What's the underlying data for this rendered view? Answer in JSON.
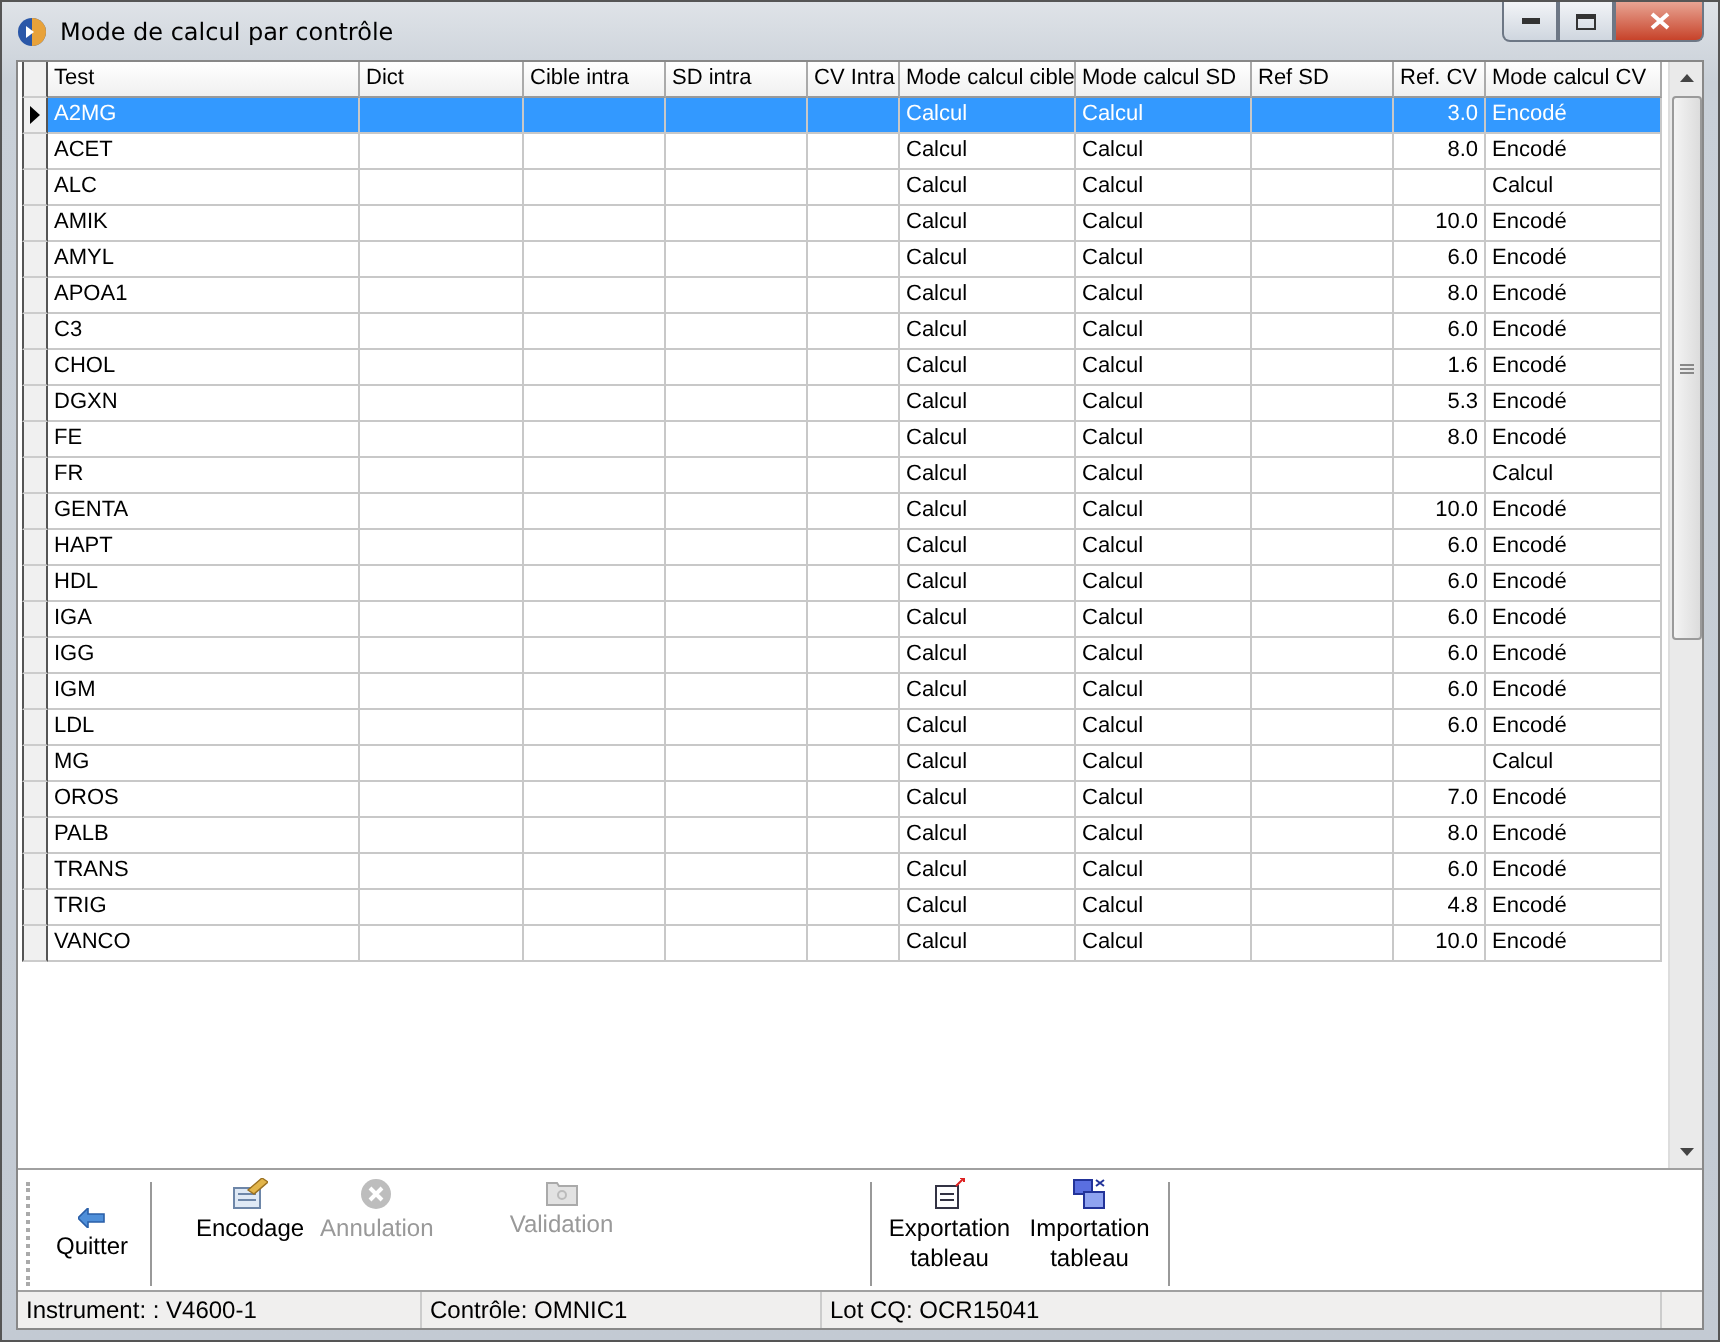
{
  "window": {
    "title": "Mode de calcul par contrôle"
  },
  "table": {
    "columns": [
      "Test",
      "Dict",
      "Cible intra",
      "SD intra",
      "CV Intra",
      "Mode calcul cible",
      "Mode calcul SD",
      "Ref SD",
      "Ref. CV",
      "Mode calcul CV"
    ],
    "rows": [
      {
        "test": "A2MG",
        "mode_cible": "Calcul",
        "mode_sd": "Calcul",
        "ref_cv": "3.0",
        "mode_cv": "Encodé",
        "selected": true
      },
      {
        "test": "ACET",
        "mode_cible": "Calcul",
        "mode_sd": "Calcul",
        "ref_cv": "8.0",
        "mode_cv": "Encodé",
        "selected": false
      },
      {
        "test": "ALC",
        "mode_cible": "Calcul",
        "mode_sd": "Calcul",
        "mode_cv": "Calcul",
        "selected": false
      },
      {
        "test": "AMIK",
        "mode_cible": "Calcul",
        "mode_sd": "Calcul",
        "ref_cv": "10.0",
        "mode_cv": "Encodé",
        "selected": false
      },
      {
        "test": "AMYL",
        "mode_cible": "Calcul",
        "mode_sd": "Calcul",
        "ref_cv": "6.0",
        "mode_cv": "Encodé",
        "selected": false
      },
      {
        "test": "APOA1",
        "mode_cible": "Calcul",
        "mode_sd": "Calcul",
        "ref_cv": "8.0",
        "mode_cv": "Encodé",
        "selected": false
      },
      {
        "test": "C3",
        "mode_cible": "Calcul",
        "mode_sd": "Calcul",
        "ref_cv": "6.0",
        "mode_cv": "Encodé",
        "selected": false
      },
      {
        "test": "CHOL",
        "mode_cible": "Calcul",
        "mode_sd": "Calcul",
        "ref_cv": "1.6",
        "mode_cv": "Encodé",
        "selected": false
      },
      {
        "test": "DGXN",
        "mode_cible": "Calcul",
        "mode_sd": "Calcul",
        "ref_cv": "5.3",
        "mode_cv": "Encodé",
        "selected": false
      },
      {
        "test": "FE",
        "mode_cible": "Calcul",
        "mode_sd": "Calcul",
        "ref_cv": "8.0",
        "mode_cv": "Encodé",
        "selected": false
      },
      {
        "test": "FR",
        "mode_cible": "Calcul",
        "mode_sd": "Calcul",
        "mode_cv": "Calcul",
        "selected": false
      },
      {
        "test": "GENTA",
        "mode_cible": "Calcul",
        "mode_sd": "Calcul",
        "ref_cv": "10.0",
        "mode_cv": "Encodé",
        "selected": false
      },
      {
        "test": "HAPT",
        "mode_cible": "Calcul",
        "mode_sd": "Calcul",
        "ref_cv": "6.0",
        "mode_cv": "Encodé",
        "selected": false
      },
      {
        "test": "HDL",
        "mode_cible": "Calcul",
        "mode_sd": "Calcul",
        "ref_cv": "6.0",
        "mode_cv": "Encodé",
        "selected": false
      },
      {
        "test": "IGA",
        "mode_cible": "Calcul",
        "mode_sd": "Calcul",
        "ref_cv": "6.0",
        "mode_cv": "Encodé",
        "selected": false
      },
      {
        "test": "IGG",
        "mode_cible": "Calcul",
        "mode_sd": "Calcul",
        "ref_cv": "6.0",
        "mode_cv": "Encodé",
        "selected": false
      },
      {
        "test": "IGM",
        "mode_cible": "Calcul",
        "mode_sd": "Calcul",
        "ref_cv": "6.0",
        "mode_cv": "Encodé",
        "selected": false
      },
      {
        "test": "LDL",
        "mode_cible": "Calcul",
        "mode_sd": "Calcul",
        "ref_cv": "6.0",
        "mode_cv": "Encodé",
        "selected": false
      },
      {
        "test": "MG",
        "mode_cible": "Calcul",
        "mode_sd": "Calcul",
        "mode_cv": "Calcul",
        "selected": false
      },
      {
        "test": "OROS",
        "mode_cible": "Calcul",
        "mode_sd": "Calcul",
        "ref_cv": "7.0",
        "mode_cv": "Encodé",
        "selected": false
      },
      {
        "test": "PALB",
        "mode_cible": "Calcul",
        "mode_sd": "Calcul",
        "ref_cv": "8.0",
        "mode_cv": "Encodé",
        "selected": false
      },
      {
        "test": "TRANS",
        "mode_cible": "Calcul",
        "mode_sd": "Calcul",
        "ref_cv": "6.0",
        "mode_cv": "Encodé",
        "selected": false
      },
      {
        "test": "TRIG",
        "mode_cible": "Calcul",
        "mode_sd": "Calcul",
        "ref_cv": "4.8",
        "mode_cv": "Encodé",
        "selected": false
      },
      {
        "test": "VANCO",
        "mode_cible": "Calcul",
        "mode_sd": "Calcul",
        "ref_cv": "10.0",
        "mode_cv": "Encodé",
        "selected": false
      }
    ]
  },
  "toolbar": [
    {
      "kind": "quit",
      "label": "Quitter",
      "disabled": false,
      "separator_before": false
    },
    {
      "kind": "edit",
      "label": "Encodage",
      "disabled": false,
      "separator_before": true
    },
    {
      "kind": "cancel",
      "label": "Annulation",
      "disabled": true,
      "separator_before": false
    },
    {
      "kind": "validate",
      "label": "Validation",
      "disabled": true,
      "separator_before": false
    },
    {
      "kind": "export",
      "label": "Exportation tableau",
      "disabled": false,
      "separator_before": true
    },
    {
      "kind": "import",
      "label": "Importation tableau",
      "disabled": false,
      "separator_before": false
    }
  ],
  "status_bar": [
    "Instrument: : V4600-1",
    "Contrôle: OMNIC1",
    "Lot CQ: OCR15041"
  ]
}
